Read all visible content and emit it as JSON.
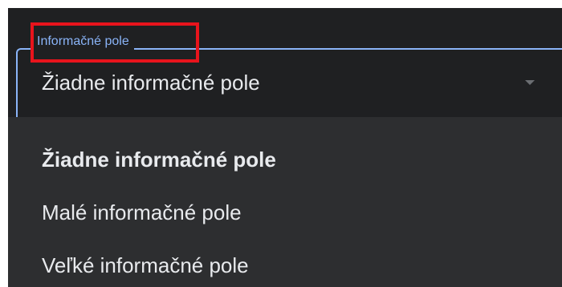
{
  "field": {
    "label": "Informačné pole",
    "selected_value": "Žiadne informačné pole",
    "dropdown_icon": "chevron-down-icon"
  },
  "menu": {
    "items": [
      {
        "label": "Žiadne informačné pole",
        "selected": true
      },
      {
        "label": "Malé informačné pole",
        "selected": false
      },
      {
        "label": "Veľké informačné pole",
        "selected": false
      }
    ]
  },
  "colors": {
    "background": "#1f2022",
    "menu_background": "#2d2e30",
    "accent": "#8ab4f8",
    "text": "#e8eaed",
    "highlight": "#e8141c"
  }
}
